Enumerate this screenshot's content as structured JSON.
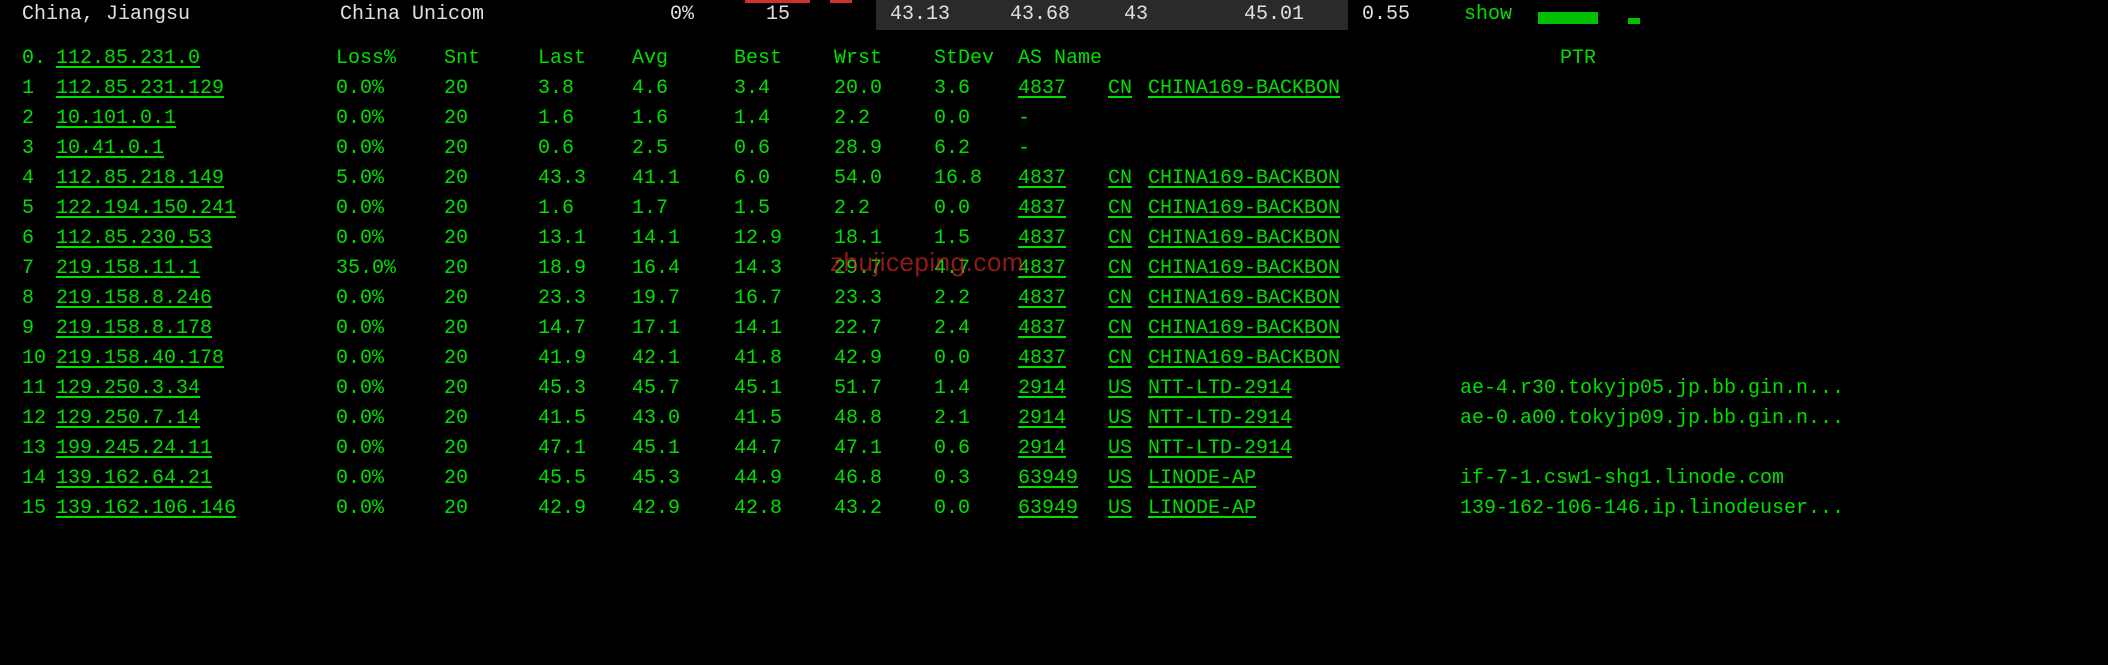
{
  "statusbar": {
    "location": "China, Jiangsu",
    "isp": "China Unicom",
    "loss_pct": "0%",
    "samples": "15",
    "last": "43.13",
    "avg": "43.68",
    "best": "43",
    "worst": "45.01",
    "stdev": "0.55",
    "action": "show"
  },
  "headers": {
    "hop": "0.",
    "ip": "112.85.231.0",
    "loss": "Loss%",
    "snt": "Snt",
    "last": "Last",
    "avg": "Avg",
    "best": "Best",
    "wrst": "Wrst",
    "stdev": "StDev",
    "asname": "AS Name",
    "ptr": "PTR"
  },
  "watermark": "zhujiceping.com",
  "hops": [
    {
      "n": "1",
      "ip": "112.85.231.129",
      "loss": "0.0%",
      "snt": "20",
      "last": "3.8",
      "avg": "4.6",
      "best": "3.4",
      "wrst": "20.0",
      "stdev": "3.6",
      "as": "4837",
      "cc": "CN",
      "name": "CHINA169-BACKBON",
      "ptr": ""
    },
    {
      "n": "2",
      "ip": "10.101.0.1",
      "loss": "0.0%",
      "snt": "20",
      "last": "1.6",
      "avg": "1.6",
      "best": "1.4",
      "wrst": "2.2",
      "stdev": "0.0",
      "as": "-",
      "cc": "",
      "name": "",
      "ptr": ""
    },
    {
      "n": "3",
      "ip": "10.41.0.1",
      "loss": "0.0%",
      "snt": "20",
      "last": "0.6",
      "avg": "2.5",
      "best": "0.6",
      "wrst": "28.9",
      "stdev": "6.2",
      "as": "-",
      "cc": "",
      "name": "",
      "ptr": ""
    },
    {
      "n": "4",
      "ip": "112.85.218.149",
      "loss": "5.0%",
      "snt": "20",
      "last": "43.3",
      "avg": "41.1",
      "best": "6.0",
      "wrst": "54.0",
      "stdev": "16.8",
      "as": "4837",
      "cc": "CN",
      "name": "CHINA169-BACKBON",
      "ptr": ""
    },
    {
      "n": "5",
      "ip": "122.194.150.241",
      "loss": "0.0%",
      "snt": "20",
      "last": "1.6",
      "avg": "1.7",
      "best": "1.5",
      "wrst": "2.2",
      "stdev": "0.0",
      "as": "4837",
      "cc": "CN",
      "name": "CHINA169-BACKBON",
      "ptr": ""
    },
    {
      "n": "6",
      "ip": "112.85.230.53",
      "loss": "0.0%",
      "snt": "20",
      "last": "13.1",
      "avg": "14.1",
      "best": "12.9",
      "wrst": "18.1",
      "stdev": "1.5",
      "as": "4837",
      "cc": "CN",
      "name": "CHINA169-BACKBON",
      "ptr": ""
    },
    {
      "n": "7",
      "ip": "219.158.11.1",
      "loss": "35.0%",
      "snt": "20",
      "last": "18.9",
      "avg": "16.4",
      "best": "14.3",
      "wrst": "29.7",
      "stdev": "4.7",
      "as": "4837",
      "cc": "CN",
      "name": "CHINA169-BACKBON",
      "ptr": ""
    },
    {
      "n": "8",
      "ip": "219.158.8.246",
      "loss": "0.0%",
      "snt": "20",
      "last": "23.3",
      "avg": "19.7",
      "best": "16.7",
      "wrst": "23.3",
      "stdev": "2.2",
      "as": "4837",
      "cc": "CN",
      "name": "CHINA169-BACKBON",
      "ptr": ""
    },
    {
      "n": "9",
      "ip": "219.158.8.178",
      "loss": "0.0%",
      "snt": "20",
      "last": "14.7",
      "avg": "17.1",
      "best": "14.1",
      "wrst": "22.7",
      "stdev": "2.4",
      "as": "4837",
      "cc": "CN",
      "name": "CHINA169-BACKBON",
      "ptr": ""
    },
    {
      "n": "10",
      "ip": "219.158.40.178",
      "loss": "0.0%",
      "snt": "20",
      "last": "41.9",
      "avg": "42.1",
      "best": "41.8",
      "wrst": "42.9",
      "stdev": "0.0",
      "as": "4837",
      "cc": "CN",
      "name": "CHINA169-BACKBON",
      "ptr": ""
    },
    {
      "n": "11",
      "ip": "129.250.3.34",
      "loss": "0.0%",
      "snt": "20",
      "last": "45.3",
      "avg": "45.7",
      "best": "45.1",
      "wrst": "51.7",
      "stdev": "1.4",
      "as": "2914",
      "cc": "US",
      "name": "NTT-LTD-2914",
      "ptr": "ae-4.r30.tokyjp05.jp.bb.gin.n..."
    },
    {
      "n": "12",
      "ip": "129.250.7.14",
      "loss": "0.0%",
      "snt": "20",
      "last": "41.5",
      "avg": "43.0",
      "best": "41.5",
      "wrst": "48.8",
      "stdev": "2.1",
      "as": "2914",
      "cc": "US",
      "name": "NTT-LTD-2914",
      "ptr": "ae-0.a00.tokyjp09.jp.bb.gin.n..."
    },
    {
      "n": "13",
      "ip": "199.245.24.11",
      "loss": "0.0%",
      "snt": "20",
      "last": "47.1",
      "avg": "45.1",
      "best": "44.7",
      "wrst": "47.1",
      "stdev": "0.6",
      "as": "2914",
      "cc": "US",
      "name": "NTT-LTD-2914",
      "ptr": ""
    },
    {
      "n": "14",
      "ip": "139.162.64.21",
      "loss": "0.0%",
      "snt": "20",
      "last": "45.5",
      "avg": "45.3",
      "best": "44.9",
      "wrst": "46.8",
      "stdev": "0.3",
      "as": "63949",
      "cc": "US",
      "name": "LINODE-AP",
      "ptr": "if-7-1.csw1-shg1.linode.com"
    },
    {
      "n": "15",
      "ip": "139.162.106.146",
      "loss": "0.0%",
      "snt": "20",
      "last": "42.9",
      "avg": "42.9",
      "best": "42.8",
      "wrst": "43.2",
      "stdev": "0.0",
      "as": "63949",
      "cc": "US",
      "name": "LINODE-AP",
      "ptr": "139-162-106-146.ip.linodeuser..."
    }
  ]
}
